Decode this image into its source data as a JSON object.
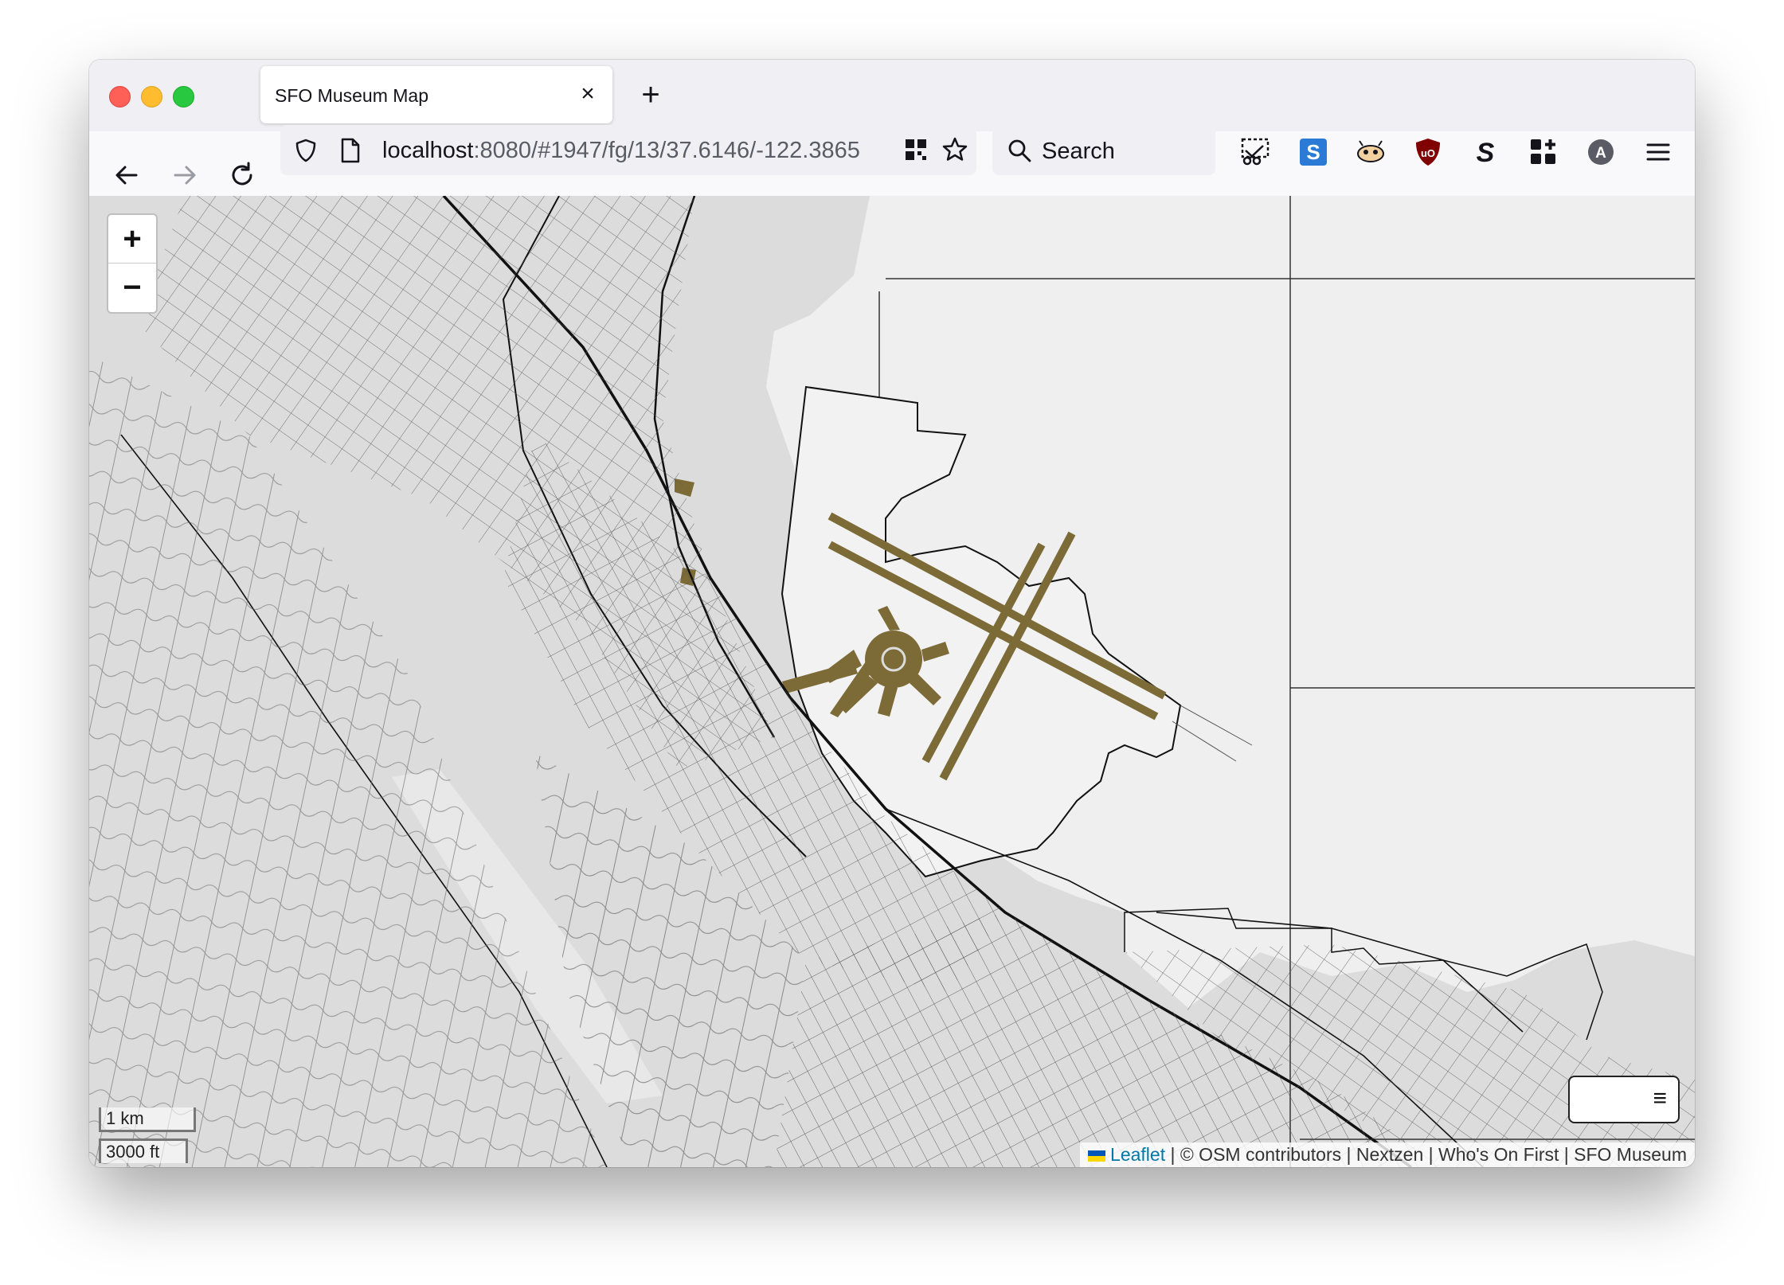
{
  "window": {
    "tab_title": "SFO Museum Map",
    "new_tab_label": "+",
    "close_tab_label": "×"
  },
  "navbar": {
    "url_host": "localhost",
    "url_rest": ":8080/#1947/fg/13/37.6146/-122.3865",
    "search_placeholder": "Search",
    "extensions": [
      "scissors-extension-icon",
      "s-blue-extension-icon",
      "creature-extension-icon",
      "ublock-origin-icon",
      "s-extension-icon",
      "grid-plus-extension-icon",
      "account-avatar-icon",
      "hamburger-menu-icon"
    ]
  },
  "map": {
    "zoom_in_label": "+",
    "zoom_out_label": "−",
    "scale_metric": "1 km",
    "scale_imperial": "3000 ft",
    "attribution": {
      "leaflet": "Leaflet",
      "rest": " | © OSM contributors | Nextzen | Who's On First | SFO Museum"
    },
    "layers_icon": "≡",
    "colors": {
      "land": "#dcdcdc",
      "water": "#efefef",
      "airport": "#7c6b36",
      "roads": "#333333"
    }
  }
}
